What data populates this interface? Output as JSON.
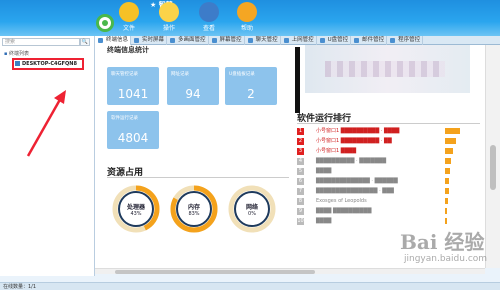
{
  "toolbar": {
    "brand": "★ 智慧",
    "buttons": [
      {
        "label": "文件",
        "icon": "file-icon",
        "color": "#f6c126"
      },
      {
        "label": "操作",
        "icon": "lightbulb-icon",
        "color": "#fbd349"
      },
      {
        "label": "查看",
        "icon": "magnifier-icon",
        "color": "#3d7cc9"
      },
      {
        "label": "帮助",
        "icon": "help-icon",
        "color": "#f5a623"
      }
    ]
  },
  "tabs": [
    "终端信息",
    "实时屏幕",
    "多画面管控",
    "屏幕管控",
    "聊天管控",
    "上网管控",
    "U盘管控",
    "邮件管控",
    "程序管控"
  ],
  "sidebar": {
    "search_placeholder": "搜索",
    "search_button": "🔍",
    "tree_root": "终端列表",
    "tree_node": "DESKTOP-C4GFQN8"
  },
  "main": {
    "cut_title": "终端信息统计",
    "cards": [
      {
        "label": "聊天管控记录",
        "value": "1041"
      },
      {
        "label": "网址记录",
        "value": "94"
      },
      {
        "label": "U盘插拔记录",
        "value": "2"
      },
      {
        "label": "软件运行记录",
        "value": "4804"
      }
    ],
    "resources": {
      "title": "资源占用",
      "items": [
        {
          "label": "处理器",
          "value": "43%",
          "percent": 43
        },
        {
          "label": "内存",
          "value": "83%",
          "percent": 83
        },
        {
          "label": "网络",
          "value": "0%",
          "percent": 0
        }
      ]
    },
    "ranking": {
      "title": "软件运行排行",
      "rows": [
        {
          "num": "1",
          "text": "小号窗口1 ██████████ · ████",
          "color": "#e02020",
          "bar": 0.3
        },
        {
          "num": "2",
          "text": "小号窗口1 ██████████ · ██",
          "color": "#e02020",
          "bar": 0.22
        },
        {
          "num": "3",
          "text": "小号窗口1 ████",
          "color": "#e02020",
          "bar": 0.15
        },
        {
          "num": "4",
          "text": "██████████ · ███████",
          "color": "#bbbbbb",
          "bar": 0.12
        },
        {
          "num": "5",
          "text": "████",
          "color": "#bbbbbb",
          "bar": 0.1
        },
        {
          "num": "6",
          "text": "██████████████ · ██████",
          "color": "#bbbbbb",
          "bar": 0.08
        },
        {
          "num": "7",
          "text": "████████████████ · ███",
          "color": "#bbbbbb",
          "bar": 0.07
        },
        {
          "num": "8",
          "text": "Exosges of Leopolds",
          "color": "#bbbbbb",
          "bar": 0.05
        },
        {
          "num": "9",
          "text": "████ ██████████",
          "color": "#bbbbbb",
          "bar": 0.04
        },
        {
          "num": "10",
          "text": "████",
          "color": "#bbbbbb",
          "bar": 0.03
        }
      ]
    }
  },
  "status": "在线数量：1/1",
  "watermark": {
    "line1": "Bai 经验",
    "line2": "jingyan.baidu.com"
  },
  "colors": {
    "accent": "#2a9ae8",
    "card": "#8dc3ec",
    "ring": "#f4a21c",
    "ring_empty": "#f1e0b8",
    "donut_center": "#1e3a5c"
  }
}
